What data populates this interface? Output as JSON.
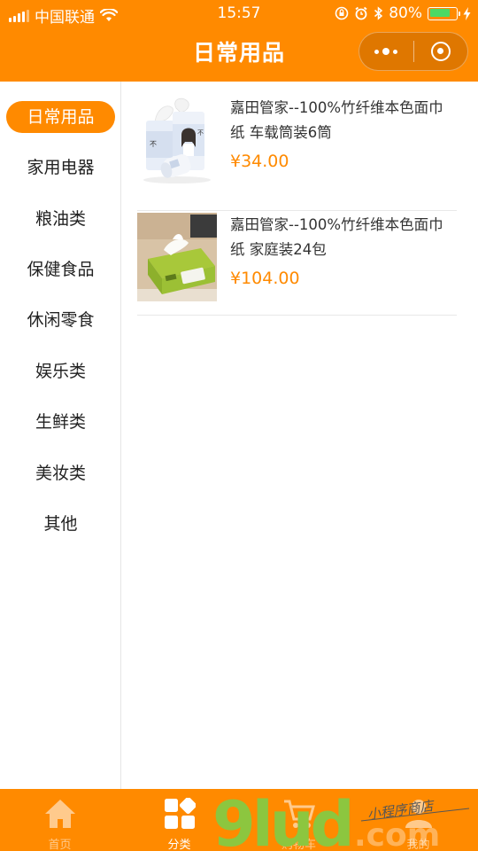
{
  "status_bar": {
    "carrier": "中国联通",
    "time": "15:57",
    "battery": "80%",
    "battery_level": 0.8,
    "icons": [
      "signal-icon",
      "wifi-icon",
      "orientation-lock-icon",
      "alarm-icon",
      "bluetooth-icon",
      "battery-icon",
      "charging-icon"
    ]
  },
  "nav": {
    "title": "日常用品",
    "icons": [
      "more-icon",
      "close-target-icon"
    ]
  },
  "sidebar": {
    "items": [
      {
        "label": "日常用品",
        "active": true
      },
      {
        "label": "家用电器",
        "active": false
      },
      {
        "label": "粮油类",
        "active": false
      },
      {
        "label": "保健食品",
        "active": false
      },
      {
        "label": "休闲零食",
        "active": false
      },
      {
        "label": "娱乐类",
        "active": false
      },
      {
        "label": "生鲜类",
        "active": false
      },
      {
        "label": "美妆类",
        "active": false
      },
      {
        "label": "其他",
        "active": false
      }
    ]
  },
  "products": [
    {
      "name": "嘉田管家--100%竹纤维本色面巾纸 车载筒装6筒",
      "price": "¥34.00",
      "image": "tissue-canisters-image"
    },
    {
      "name": "嘉田管家--100%竹纤维本色面巾纸 家庭装24包",
      "price": "¥104.00",
      "image": "tissue-pack-image"
    }
  ],
  "tabbar": {
    "items": [
      {
        "label": "首页",
        "icon": "home-icon",
        "active": false
      },
      {
        "label": "分类",
        "icon": "category-icon",
        "active": true
      },
      {
        "label": "购物车",
        "icon": "cart-icon",
        "active": false
      },
      {
        "label": "我的",
        "icon": "user-icon",
        "active": false
      }
    ]
  },
  "watermark": {
    "brand": "9lud",
    "domain": ".com",
    "tagline": "小程序商店"
  },
  "colors": {
    "accent": "#ff8a00",
    "battery": "#4cd964",
    "watermark_green": "#8cc63f"
  }
}
